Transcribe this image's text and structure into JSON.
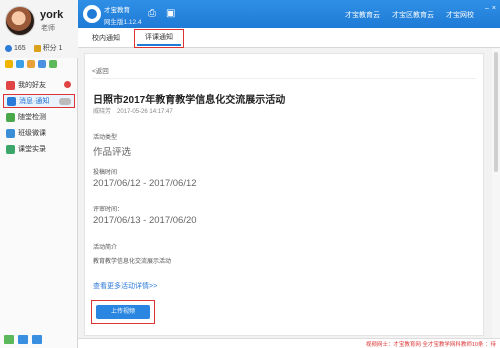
{
  "user": {
    "name": "york",
    "role": "老师",
    "coins": "165",
    "points_label": "积分 1"
  },
  "sidebar": {
    "items": [
      {
        "label": "我的好友",
        "badge": "",
        "color": "#e04444"
      },
      {
        "label": "消息·通知",
        "badge": "",
        "color": "#2a7ad9"
      },
      {
        "label": "随堂检测",
        "color": "#4aa84a"
      },
      {
        "label": "班级微课",
        "color": "#3b8fd6"
      },
      {
        "label": "课堂实录",
        "color": "#3ca66a"
      }
    ]
  },
  "header": {
    "app_name": "才宝教育",
    "version": "网生版1.12.4",
    "links": [
      "才宝教育云",
      "才宝区教育云",
      "才宝网校"
    ]
  },
  "tabs": [
    {
      "label": "校内通知",
      "count": ""
    },
    {
      "label": "评课通知"
    }
  ],
  "detail": {
    "back": "<返回",
    "title": "日照市2017年教育教学信息化交流展示活动",
    "author": "戚晓芳",
    "time": "2017-05-26 14:17:47",
    "fields": [
      {
        "label": "活动类型",
        "value": "作品评选"
      },
      {
        "label": "投稿时间",
        "value": "2017/06/12 - 2017/06/12"
      },
      {
        "label": "评审时间：",
        "value": "2017/06/13 - 2017/06/20"
      },
      {
        "label": "活动简介",
        "value": "教育教学信息化交流展示活动"
      }
    ],
    "more_link": "查看更多活动详情>>",
    "upload_button": "上传视频"
  },
  "status": {
    "text": "视频网士：才宝教育网 全才宝教学网科教师10条 ：待"
  },
  "colors": {
    "accent": "#1f7bd6",
    "highlight": "#dd3333"
  }
}
